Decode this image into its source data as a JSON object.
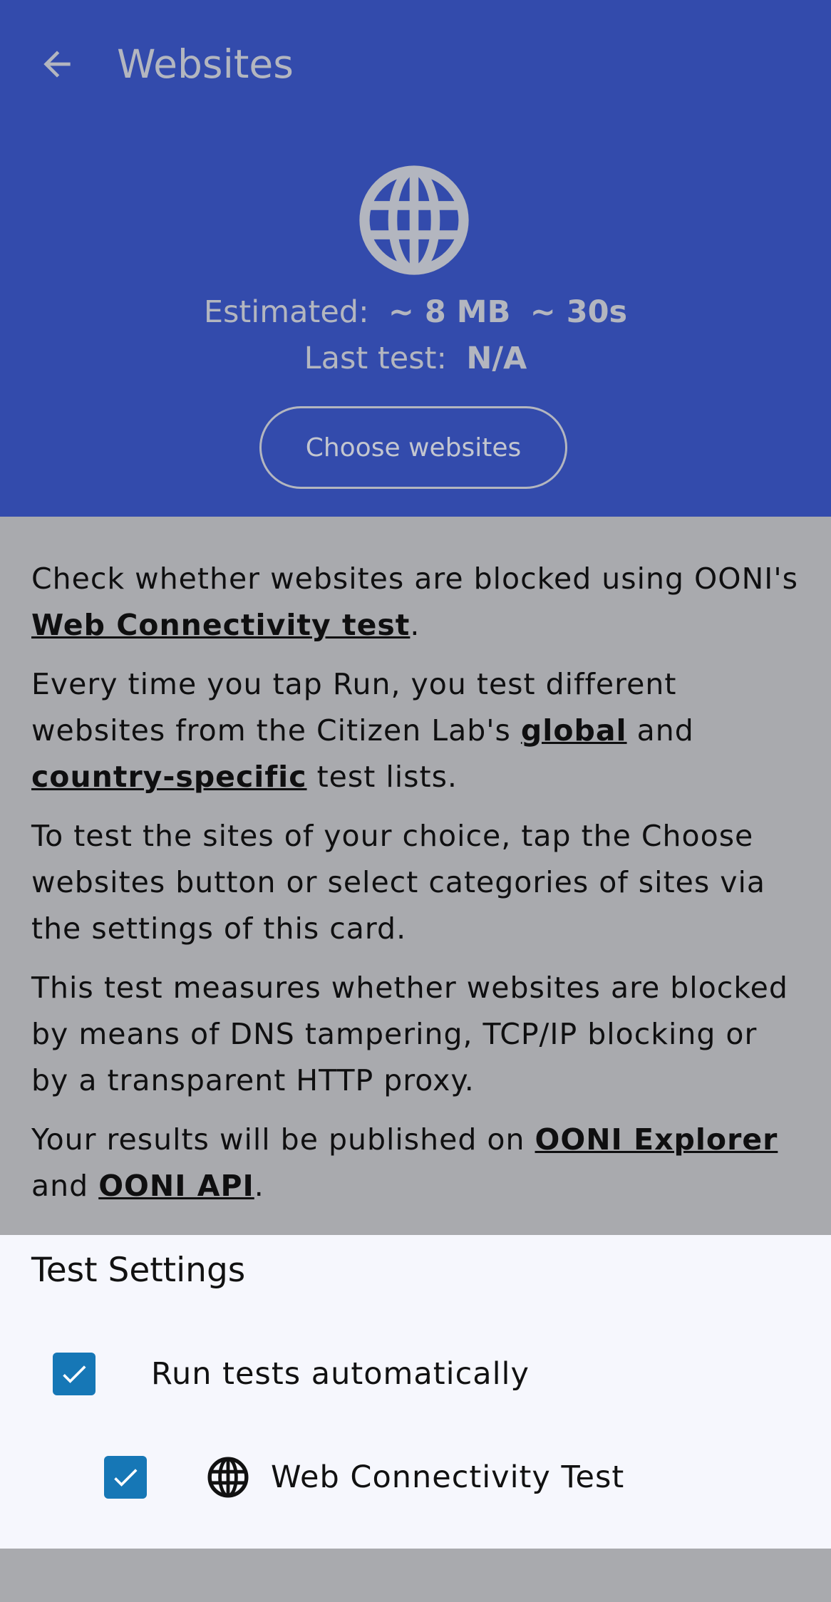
{
  "header": {
    "title": "Websites",
    "back_icon": "arrow-back-icon",
    "test_icon": "globe-icon",
    "estimated_label": "Estimated:",
    "estimated_size": "~ 8 MB",
    "estimated_time": "~ 30s",
    "last_test_label": "Last test:",
    "last_test_value": "N/A",
    "choose_button": "Choose websites",
    "background_color": "#334bac"
  },
  "description": {
    "p1_text": "Check whether websites are blocked using OONI's",
    "p1_link": "Web Connectivity test",
    "p1_end": ".",
    "p2_text": "Every time you tap Run, you test different websites from the Citizen Lab's",
    "p2_link1": "global",
    "p2_and": "and",
    "p2_link2": "country-specific",
    "p2_end": "test lists.",
    "p3_text": "To test the sites of your choice, tap the Choose websites button or select categories of sites via the settings of this card.",
    "p4_text": "This test measures whether websites are blocked by means of DNS tampering, TCP/IP blocking or by a transparent HTTP proxy.",
    "p5_text": "Your results will be published on",
    "p5_link1": "OONI Explorer",
    "p5_and": "and",
    "p5_link2": "OONI API",
    "p5_end": "."
  },
  "settings": {
    "title": "Test Settings",
    "run_auto_label": "Run tests automatically",
    "run_auto_checked": true,
    "web_conn_label": "Web Connectivity Test",
    "web_conn_checked": true,
    "web_conn_icon": "globe-icon",
    "checkbox_color": "#1677b6"
  }
}
